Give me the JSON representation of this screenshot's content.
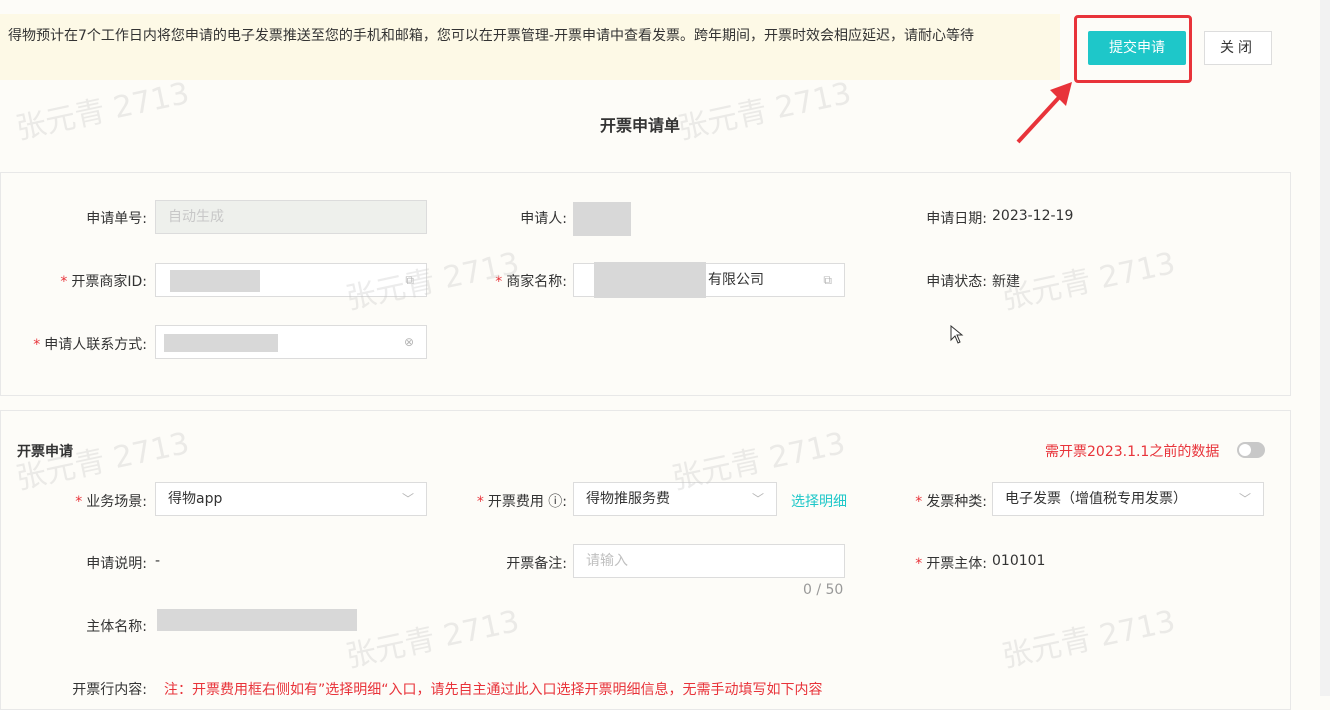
{
  "notice": {
    "text": "得物预计在7个工作日内将您申请的电子发票推送至您的手机和邮箱，您可以在开票管理-开票申请中查看发票。跨年期间，开票时效会相应延迟，请耐心等待"
  },
  "actions": {
    "submit": "提交申请",
    "close": "关闭"
  },
  "form_title": "开票申请单",
  "basic": {
    "apply_no_label": "申请单号:",
    "apply_no_placeholder": "自动生成",
    "applicant_label": "申请人:",
    "apply_date_label": "申请日期:",
    "apply_date_value": "2023-12-19",
    "merchant_id_label": "开票商家ID:",
    "merchant_name_label": "商家名称:",
    "merchant_name_value": "有限公司",
    "status_label": "申请状态:",
    "status_value": "新建",
    "contact_label": "申请人联系方式:"
  },
  "invoice": {
    "section_title": "开票申请",
    "toggle_label": "需开票2023.1.1之前的数据",
    "scene_label": "业务场景:",
    "scene_value": "得物app",
    "fee_label": "开票费用 ⓘ:",
    "fee_value": "得物推服务费",
    "select_detail": "选择明细",
    "type_label": "发票种类:",
    "type_value": "电子发票（增值税专用发票）",
    "desc_label": "申请说明:",
    "desc_value": "-",
    "remark_label": "开票备注:",
    "remark_placeholder": "请输入",
    "remark_counter": "0 / 50",
    "entity_label": "开票主体:",
    "entity_value": "010101",
    "entity_name_label": "主体名称:",
    "line_label": "开票行内容:",
    "line_note": "注：开票费用框右侧如有”选择明细“入口，请先自主通过此入口选择开票明细信息，无需手动填写如下内容"
  },
  "watermark": "张元青 2713"
}
